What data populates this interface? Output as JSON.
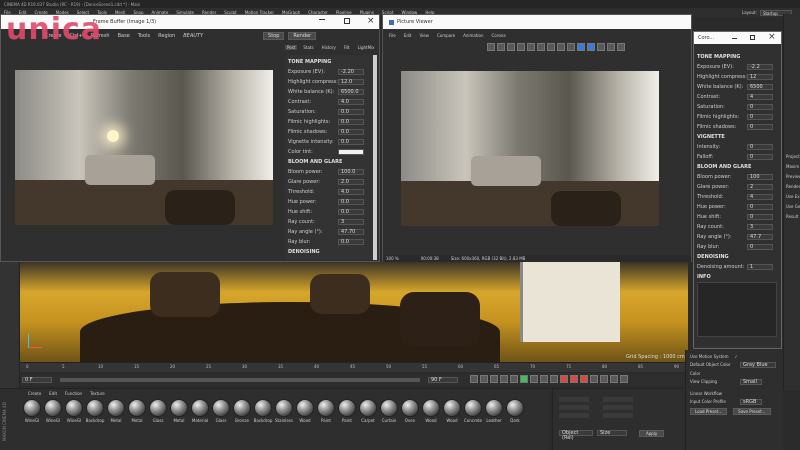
{
  "main_window": {
    "title": "CINEMA 4D R19.037 Studio (RC - R19) - [DanceScene1.c4d *] - Main",
    "menu": [
      "File",
      "Edit",
      "Create",
      "Modes",
      "Select",
      "Tools",
      "Mesh",
      "Snap",
      "Animate",
      "Simulate",
      "Render",
      "Sculpt",
      "Motion Tracker",
      "MoGraph",
      "Character",
      "Pipeline",
      "Plugins",
      "Script",
      "Window",
      "Help"
    ],
    "layout_label": "Layout:",
    "layout_value": "Startup",
    "toolbar2": {
      "create": "Create",
      "ctrl": "Ctrl+",
      "refresh": "Refresh",
      "base": "Base",
      "tools": "Tools",
      "region": "Region",
      "beauty": "BEAUTY"
    }
  },
  "watermark": "unica",
  "render_window": {
    "title": "Frame Buffer (Image 1/3)",
    "stop": "Stop",
    "render": "Render",
    "tabs": [
      "Post",
      "Stats",
      "History",
      "Filt",
      "LightMix"
    ],
    "tone_mapping": {
      "title": "TONE MAPPING",
      "params": [
        {
          "label": "Exposure (EV):",
          "value": "-2.20"
        },
        {
          "label": "Highlight compress:",
          "value": "12.0"
        },
        {
          "label": "White balance (K):",
          "value": "6500.0"
        },
        {
          "label": "Contrast:",
          "value": "4.0"
        },
        {
          "label": "Saturation:",
          "value": "0.0"
        },
        {
          "label": "Filmic highlights:",
          "value": "0.0"
        },
        {
          "label": "Filmic shadows:",
          "value": "0.0"
        },
        {
          "label": "Vignette intensity:",
          "value": "0.0"
        },
        {
          "label": "Color tint:",
          "value": ""
        }
      ]
    },
    "bloom": {
      "title": "BLOOM AND GLARE",
      "params": [
        {
          "label": "Bloom power:",
          "value": "100.0"
        },
        {
          "label": "Glare power:",
          "value": "2.0"
        },
        {
          "label": "Threshold:",
          "value": "4.0"
        },
        {
          "label": "Hue power:",
          "value": "0.0"
        },
        {
          "label": "Hue shift:",
          "value": "0.0"
        },
        {
          "label": "Ray count:",
          "value": "3"
        },
        {
          "label": "Ray angle (°):",
          "value": "47.70"
        },
        {
          "label": "Ray blur:",
          "value": "0.0"
        }
      ]
    },
    "denoising": "DENOISING"
  },
  "picture_viewer": {
    "title": "Picture Viewer",
    "menu": [
      "File",
      "Edit",
      "View",
      "Compare",
      "Animation",
      "Corona"
    ],
    "status_zoom": "100 %",
    "status_time": "00:00:38",
    "status_info": "Size: 600x360, RGB (32 Bit), 2.83 MB"
  },
  "corona_panel": {
    "title": "Coro...",
    "tone_mapping": {
      "title": "TONE MAPPING",
      "params": [
        {
          "label": "Exposure (EV):",
          "value": "-2.2"
        },
        {
          "label": "Highlight compress:",
          "value": "12"
        },
        {
          "label": "White balance (K):",
          "value": "6500"
        },
        {
          "label": "Contrast:",
          "value": "4"
        },
        {
          "label": "Saturation:",
          "value": "0"
        },
        {
          "label": "Filmic highlights:",
          "value": "0"
        },
        {
          "label": "Filmic shadows:",
          "value": "0"
        }
      ]
    },
    "vignette": {
      "title": "VIGNETTE",
      "params": [
        {
          "label": "Intensity:",
          "value": "0"
        },
        {
          "label": "Falloff:",
          "value": "0"
        }
      ]
    },
    "bloom": {
      "title": "BLOOM AND GLARE",
      "params": [
        {
          "label": "Bloom power:",
          "value": "100"
        },
        {
          "label": "Glare power:",
          "value": "2"
        },
        {
          "label": "Threshold:",
          "value": "4"
        },
        {
          "label": "Hue power:",
          "value": "0"
        },
        {
          "label": "Hue shift:",
          "value": "0"
        },
        {
          "label": "Ray count:",
          "value": "3"
        },
        {
          "label": "Ray angle (°):",
          "value": "47.7"
        },
        {
          "label": "Ray blur:",
          "value": "0"
        }
      ]
    },
    "denoising": {
      "title": "DENOISING",
      "amount_label": "Denoising amount:",
      "amount_value": "1"
    },
    "info_title": "INFO"
  },
  "viewport": {
    "grid_spacing": "Grid Spacing : 1000 cm"
  },
  "timeline": {
    "start": "0 F",
    "end": "90 F",
    "ticks": [
      "0",
      "5",
      "10",
      "15",
      "20",
      "25",
      "30",
      "35",
      "40",
      "45",
      "50",
      "55",
      "60",
      "65",
      "70",
      "75",
      "80",
      "85",
      "90"
    ],
    "current": "0 F"
  },
  "material_manager": {
    "menu": [
      "Create",
      "Edit",
      "Function",
      "Texture"
    ],
    "materials": [
      "WineGl",
      "WineGl",
      "WineGl",
      "Backdrop",
      "Metal",
      "Metal",
      "Glass",
      "Metal",
      "Material",
      "Glass",
      "Bronze",
      "Backdrop",
      "Stainless",
      "Wood",
      "Paint",
      "Paint",
      "Carpet",
      "Curtain",
      "Oven",
      "Wood",
      "Wood",
      "Concrete",
      "Leather",
      "Dark"
    ],
    "logo": "MAXON CINEMA 4D"
  },
  "attributes": {
    "use_motion_system": "Use Motion System",
    "default_object_color_label": "Default Object Color",
    "default_object_color_value": "Gray Blue",
    "color_label": "Color",
    "view_clipping_label": "View Clipping",
    "view_clipping_value": "Small",
    "linear_workflow": "Linear Workflow",
    "input_color_profile_label": "Input Color Profile",
    "input_color_profile_value": "sRGB",
    "load_preset": "Load Preset...",
    "save_preset": "Save Preset..."
  },
  "coords": {
    "object_label": "Object (Rel)",
    "size_label": "Size",
    "apply": "Apply"
  },
  "right_cut_labels": [
    "Project",
    "Maxim",
    "Preview",
    "Render",
    "Use Ex",
    "Use Ge",
    "Result"
  ]
}
